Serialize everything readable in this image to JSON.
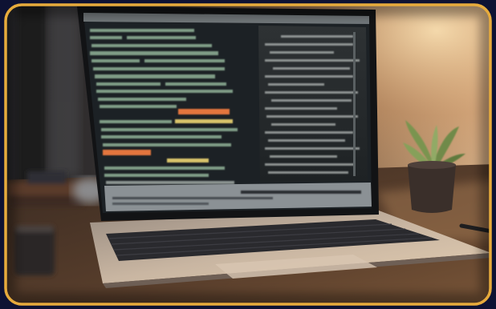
{
  "frame": {
    "border_color": "#e7ab3c",
    "outer_background": "#0e1233"
  },
  "screen": {
    "code_color": "#7f9c86",
    "highlight_color": "#e4763c",
    "keyword_color": "#d9c46a",
    "panel_color": "#1c2125"
  },
  "plant": {
    "leaf_color": "#7a9450"
  }
}
